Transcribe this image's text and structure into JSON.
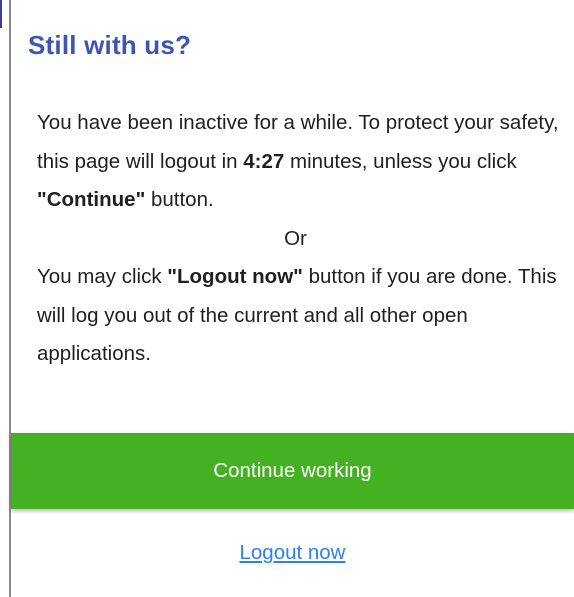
{
  "dialog": {
    "title": "Still with us?",
    "message": {
      "line1_before_time": "You have been inactive for a while. To protect your safety, this page will logout in ",
      "time_remaining": "4:27",
      "line1_after_time": " minutes, unless you click ",
      "quote_open_1": "\"",
      "continue_ref": "Continue",
      "quote_close_1": "\"",
      "line1_end": " button.",
      "or_text": "Or",
      "line2_start": "You may click ",
      "quote_open_2": "\"",
      "logout_ref": "Logout now",
      "quote_close_2": "\"",
      "line2_end": " button if you are done. This will log you out of the current and all other open applications."
    },
    "continue_button_label": "Continue working",
    "logout_link_label": "Logout now",
    "colors": {
      "title": "#3d55b4",
      "continue_button": "#43b121",
      "link": "#2f80ed"
    }
  }
}
